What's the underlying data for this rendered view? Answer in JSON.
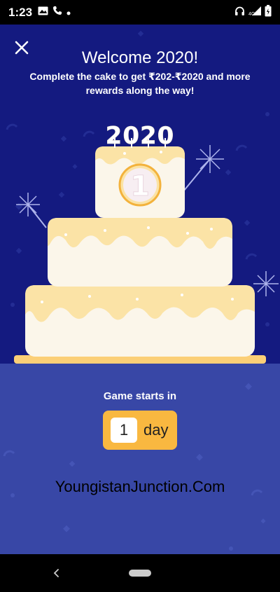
{
  "status_bar": {
    "time": "1:23",
    "left_icons": [
      "image-icon",
      "phone-icon",
      "dot-icon"
    ],
    "right_icons": [
      "headphones-icon",
      "signal-icon",
      "battery-icon"
    ]
  },
  "header": {
    "close_icon": "close-icon",
    "title": "Welcome 2020!",
    "subtitle": "Complete the cake to get ₹202-₹2020 and more rewards along the way!"
  },
  "cake": {
    "candles_text": "2020",
    "emblem_icon": "number-one-badge-icon"
  },
  "countdown": {
    "label": "Game starts in",
    "number": "1",
    "unit": "day"
  },
  "watermark": "YoungistanJunction.Com",
  "nav": {
    "back_icon": "back-chevron-icon",
    "home_icon": "home-pill-icon"
  },
  "colors": {
    "hero_bg": "#141a80",
    "panel_bg": "#3847a6",
    "counter_bg": "#f9b840",
    "cake_cream": "#fbf6ea",
    "frosting": "#fbe3a6"
  }
}
